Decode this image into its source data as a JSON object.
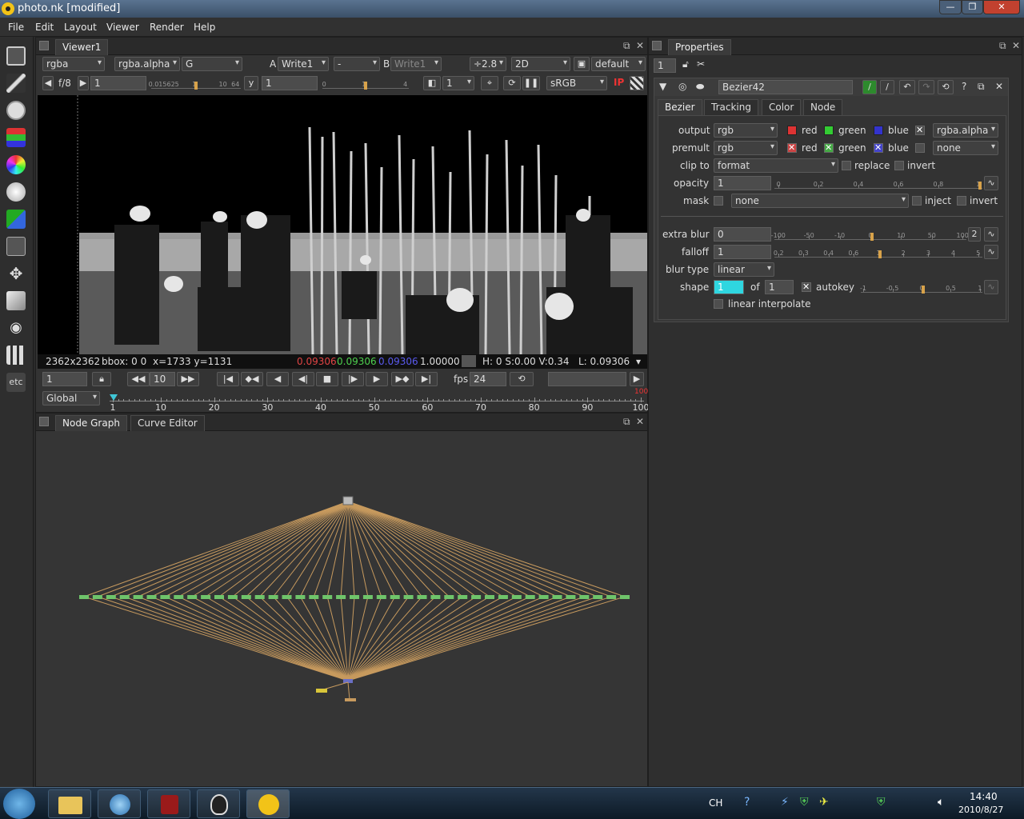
{
  "window": {
    "title": "photo.nk [modified]",
    "minimize_label": "—",
    "maximize_label": "❐",
    "close_label": "✕"
  },
  "menu": [
    "File",
    "Edit",
    "Layout",
    "Viewer",
    "Render",
    "Help"
  ],
  "toolbar": {
    "items": [
      "image-icon",
      "draw-icon",
      "time-icon",
      "channel-icon",
      "color-icon",
      "filter-icon",
      "keyer-icon",
      "merge-icon",
      "transform-icon",
      "3d-icon",
      "views-icon",
      "metadata-icon"
    ],
    "etc_label": "etc"
  },
  "viewer": {
    "tab": "Viewer1",
    "channels": "rgba",
    "alpha_channel": "rgba.alpha",
    "display_channel": "G",
    "a_label": "A",
    "input_a": "Write1",
    "a_op": "-",
    "b_label": "B",
    "input_b": "Write1",
    "downscale": "÷2.8",
    "view_mode": "2D",
    "lut_default": "default",
    "fstop": "f/8",
    "gain": "1",
    "gain_ticks": [
      "0.015625",
      "1",
      "10",
      "64"
    ],
    "y_label": "y",
    "gamma": "1",
    "gamma_ticks": [
      "0",
      "1",
      "4"
    ],
    "proxy": "1",
    "colorspace": "sRGB",
    "ip_label": "IP",
    "info": {
      "format": "2362x2362",
      "bbox": "bbox: 0 0",
      "coords": "x=1733 y=1131",
      "r": "0.09306",
      "g": "0.09306",
      "b": "0.09306",
      "a": "1.00000",
      "hsv": "H:  0 S:0.00 V:0.34",
      "lum": "L: 0.09306"
    }
  },
  "playback": {
    "frame": "1",
    "increment": "10",
    "fps_label": "fps",
    "fps": "24",
    "range_mode": "Global",
    "timeline_start": 1,
    "timeline_end": 100,
    "end_marker_label": "100",
    "timeline_labels": [
      "1",
      "10",
      "20",
      "30",
      "40",
      "50",
      "60",
      "70",
      "80",
      "90",
      "100"
    ]
  },
  "nodegraph": {
    "tabs": [
      "Node Graph",
      "Curve Editor"
    ],
    "active_tab": 0,
    "bezier_node_count": 41,
    "colors": {
      "node": "#6fc46a",
      "wire": "#c79a5e",
      "merge": "#6a6fc4",
      "write": "#d9c63a"
    }
  },
  "properties": {
    "tab": "Properties",
    "max_panels": "1",
    "node_name": "Bezier42",
    "tabs": [
      "Bezier",
      "Tracking",
      "Color",
      "Node"
    ],
    "active_tab": 0,
    "output_label": "output",
    "output": "rgb",
    "premult_label": "premult",
    "premult": "rgb",
    "ch_red": "red",
    "ch_green": "green",
    "ch_blue": "blue",
    "output_alpha": "rgba.alpha",
    "premult_alpha": "none",
    "clip_label": "clip to",
    "clip_to": "format",
    "replace_label": "replace",
    "invert_label": "invert",
    "opacity_label": "opacity",
    "opacity": "1",
    "opacity_ticks": [
      "0",
      "0.2",
      "0.4",
      "0.6",
      "0.8",
      "1"
    ],
    "mask_label": "mask",
    "mask": "none",
    "inject_label": "inject",
    "mask_invert_label": "invert",
    "extra_blur_label": "extra blur",
    "extra_blur": "0",
    "extra_blur_ticks": [
      "-100",
      "-50",
      "-10",
      "0",
      "10",
      "50",
      "100"
    ],
    "extra_blur_dim": "2",
    "falloff_label": "falloff",
    "falloff": "1",
    "falloff_ticks": [
      "0.2",
      "0.3",
      "0.4",
      "0.6",
      "1",
      "2",
      "3",
      "4",
      "5"
    ],
    "blur_type_label": "blur type",
    "blur_type": "linear",
    "shape_label": "shape",
    "shape": "1",
    "of_label": "of",
    "shape_total": "1",
    "autokey_label": "autokey",
    "shape_ticks": [
      "-1",
      "-0.5",
      "0",
      "0.5",
      "1"
    ],
    "linear_interp_label": "linear interpolate"
  },
  "taskbar": {
    "apps": [
      "explorer-icon",
      "ie-icon",
      "adobe-icon",
      "qq-icon",
      "nuke-icon"
    ],
    "tray_lang": "CH",
    "time": "14:40",
    "date": "2010/8/27"
  }
}
